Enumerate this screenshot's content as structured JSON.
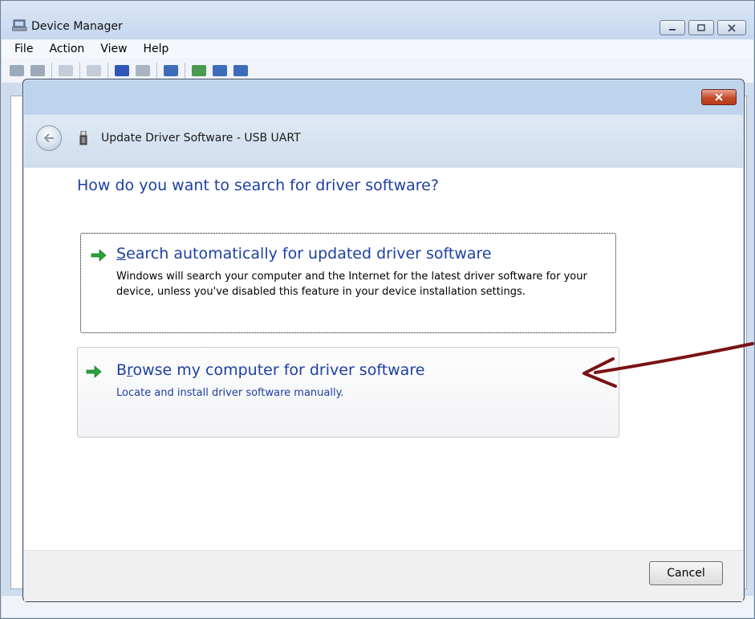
{
  "device_manager": {
    "title": "Device Manager",
    "menu": [
      "File",
      "Action",
      "View",
      "Help"
    ],
    "window_buttons": [
      "minimize",
      "maximize",
      "close"
    ]
  },
  "dialog": {
    "title": "Update Driver Software - USB UART",
    "heading": "How do you want to search for driver software?",
    "options": [
      {
        "title": "Search automatically for updated driver software",
        "accelerator": "S",
        "description": "Windows will search your computer and the Internet for the latest driver software for your device, unless you've disabled this feature in your device installation settings.",
        "icon": "green-arrow-icon"
      },
      {
        "title": "Browse my computer for driver software",
        "accelerator": "r",
        "description": "Locate and install driver software manually.",
        "icon": "green-arrow-icon"
      }
    ],
    "cancel_label": "Cancel"
  },
  "colors": {
    "link_blue": "#1e3fa2",
    "annotation_arrow": "#7a1212",
    "option_arrow_green": "#27a33a"
  }
}
